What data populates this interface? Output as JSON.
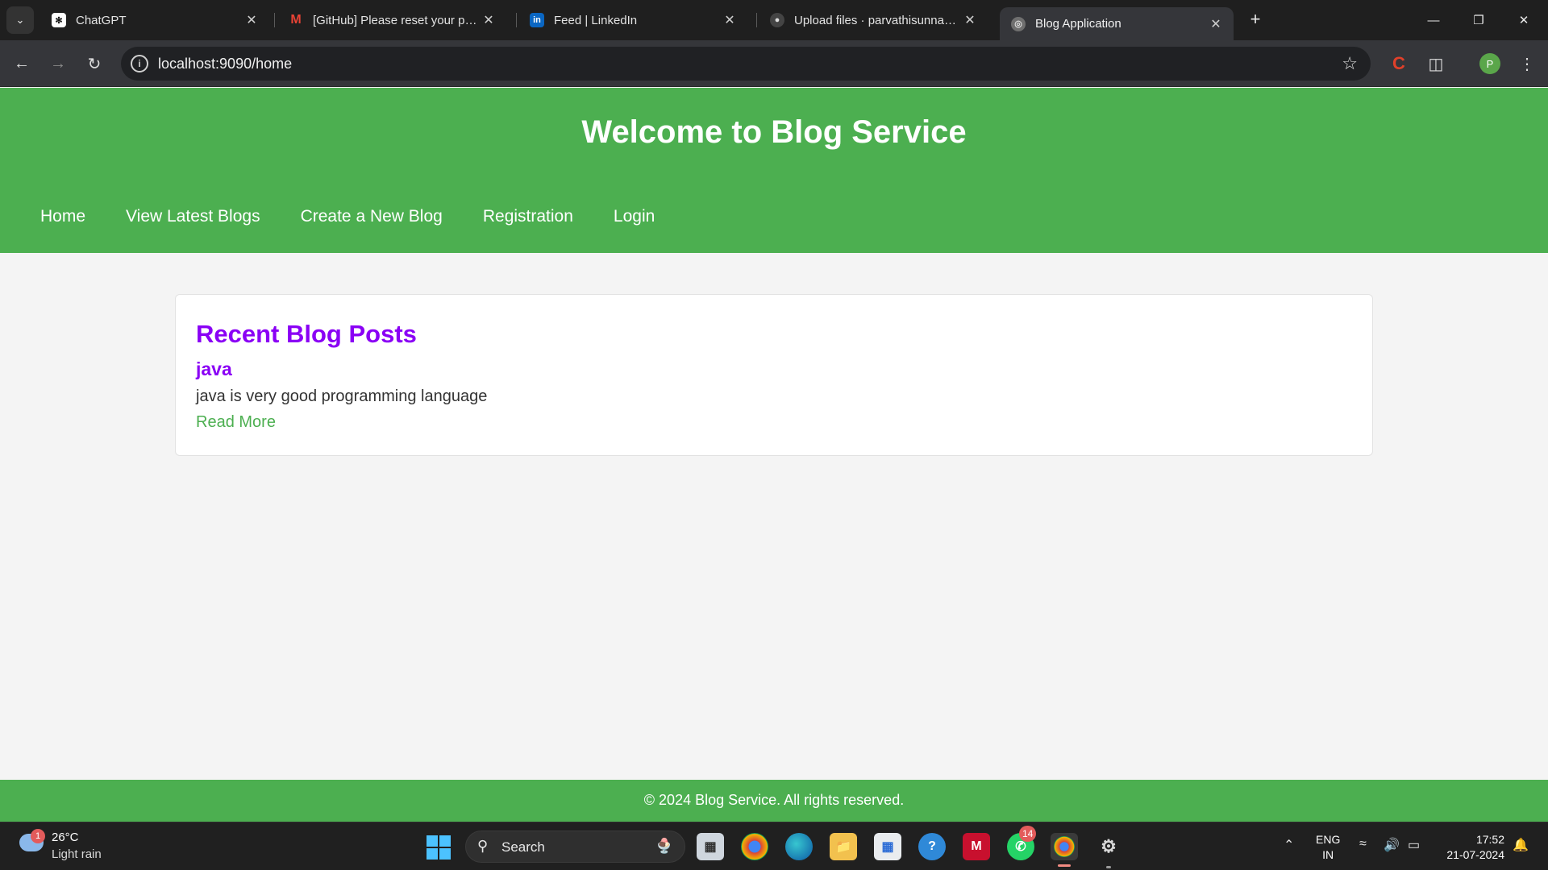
{
  "browser": {
    "tabs": [
      {
        "title": "ChatGPT",
        "favicon": "chatgpt-icon"
      },
      {
        "title": "[GitHub] Please reset your passw",
        "favicon": "gmail-icon"
      },
      {
        "title": "Feed | LinkedIn",
        "favicon": "linkedin-icon"
      },
      {
        "title": "Upload files · parvathisunnam/J",
        "favicon": "github-icon"
      },
      {
        "title": "Blog Application",
        "favicon": "globe-icon"
      }
    ],
    "active_tab": 4,
    "address": "localhost:9090/home",
    "profile_initial": "P"
  },
  "site": {
    "title": "Welcome to Blog Service",
    "nav": [
      "Home",
      "View Latest Blogs",
      "Create a New Blog",
      "Registration",
      "Login"
    ],
    "section_heading": "Recent Blog Posts",
    "posts": [
      {
        "title": "java",
        "summary": "java is very good programming language",
        "link_label": "Read More"
      }
    ],
    "footer": "© 2024 Blog Service. All rights reserved.",
    "colors": {
      "header": "#4caf50",
      "heading": "#8a00f5",
      "link": "#4caf50"
    }
  },
  "taskbar": {
    "weather": {
      "temp": "26°C",
      "desc": "Light rain",
      "badge": "1"
    },
    "search_label": "Search",
    "whatsapp_badge": "14",
    "lang_line1": "ENG",
    "lang_line2": "IN",
    "time": "17:52",
    "date": "21-07-2024"
  }
}
